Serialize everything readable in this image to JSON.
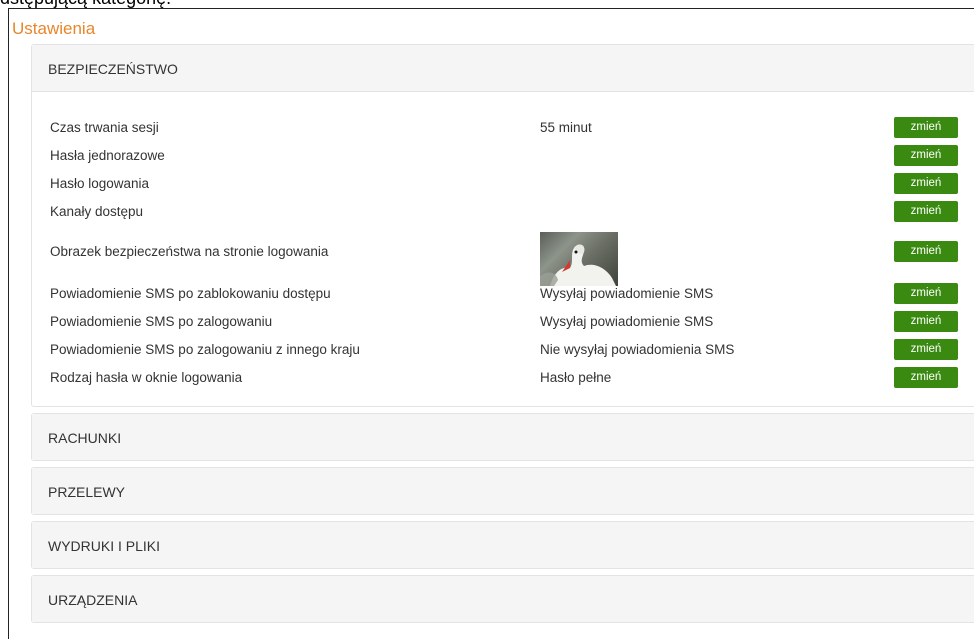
{
  "caption": "dstępującą kategorię.",
  "title": "Ustawienia",
  "sections": [
    {
      "label": "BEZPIECZEŃSTWO"
    },
    {
      "label": "RACHUNKI"
    },
    {
      "label": "PRZELEWY"
    },
    {
      "label": "WYDRUKI I PLIKI"
    },
    {
      "label": "URZĄDZENIA"
    }
  ],
  "security": {
    "rows": [
      {
        "label": "Czas trwania sesji",
        "value": "55 minut",
        "button": "zmień"
      },
      {
        "label": "Hasła jednorazowe",
        "value": "",
        "button": "zmień"
      },
      {
        "label": "Hasło logowania",
        "value": "",
        "button": "zmień"
      },
      {
        "label": "Kanały dostępu",
        "value": "",
        "button": "zmień"
      },
      {
        "label": "Obrazek bezpieczeństwa na stronie logowania",
        "value": "",
        "button": "zmień"
      },
      {
        "label": "Powiadomienie SMS po zablokowaniu dostępu",
        "value": "Wysyłaj powiadomienie SMS",
        "button": "zmień"
      },
      {
        "label": "Powiadomienie SMS po zalogowaniu",
        "value": "Wysyłaj powiadomienie SMS",
        "button": "zmień"
      },
      {
        "label": "Powiadomienie SMS po zalogowaniu z innego kraju",
        "value": "Nie wysyłaj powiadomienia SMS",
        "button": "zmień"
      },
      {
        "label": "Rodzaj hasła w oknie logowania",
        "value": "Hasło pełne",
        "button": "zmień"
      }
    ]
  },
  "colors": {
    "title": "#e8862a",
    "button": "#3a8a12",
    "panel_header": "#f5f5f5"
  }
}
